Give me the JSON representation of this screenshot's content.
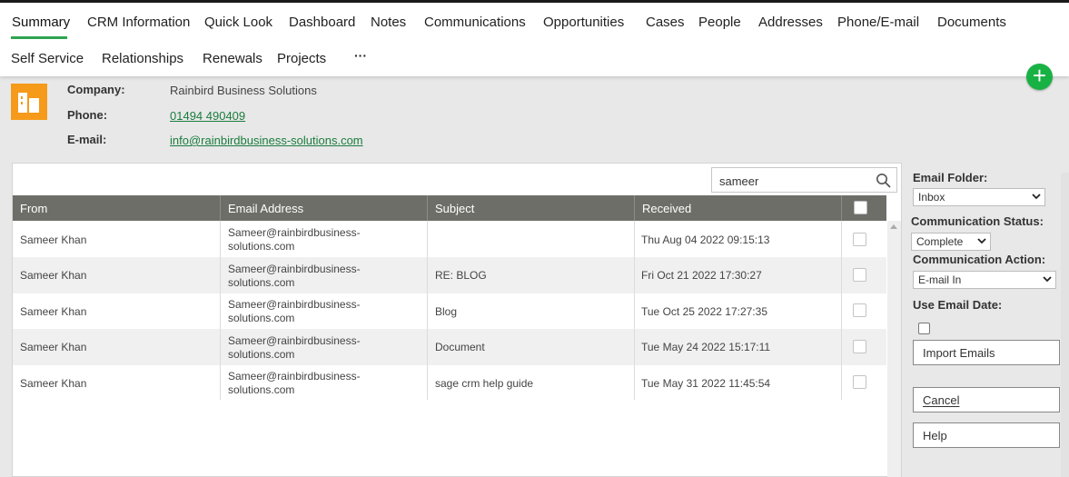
{
  "tabs": {
    "row1": [
      "Summary",
      "CRM Information",
      "Quick Look",
      "Dashboard",
      "Notes",
      "Communications",
      "Opportunities",
      "Cases",
      "People",
      "Addresses",
      "Phone/E-mail",
      "Documents"
    ],
    "row2": [
      "Self Service",
      "Relationships",
      "Renewals",
      "Projects"
    ],
    "more": "···"
  },
  "add_button": "+",
  "company": {
    "company_label": "Company:",
    "company_value": "Rainbird Business Solutions",
    "phone_label": "Phone:",
    "phone_value": "01494 490409",
    "email_label": "E-mail:",
    "email_value": "info@rainbirdbusiness-solutions.com"
  },
  "search": {
    "value": "sameer"
  },
  "table": {
    "columns": [
      "From",
      "Email Address",
      "Subject",
      "Received"
    ],
    "rows": [
      {
        "from": "Sameer Khan",
        "email_1": "Sameer@rainbirdbusiness-",
        "email_2": "solutions.com",
        "subject": "",
        "received": "Thu Aug 04 2022 09:15:13"
      },
      {
        "from": "Sameer Khan",
        "email_1": "Sameer@rainbirdbusiness-",
        "email_2": "solutions.com",
        "subject": "RE: BLOG",
        "received": "Fri Oct 21 2022 17:30:27"
      },
      {
        "from": "Sameer Khan",
        "email_1": "Sameer@rainbirdbusiness-",
        "email_2": "solutions.com",
        "subject": "Blog",
        "received": "Tue Oct 25 2022 17:27:35"
      },
      {
        "from": "Sameer Khan",
        "email_1": "Sameer@rainbirdbusiness-",
        "email_2": "solutions.com",
        "subject": "Document",
        "received": "Tue May 24 2022 15:17:11"
      },
      {
        "from": "Sameer Khan",
        "email_1": "Sameer@rainbirdbusiness-",
        "email_2": "solutions.com",
        "subject": "sage crm help guide",
        "received": "Tue May 31 2022 11:45:54"
      }
    ]
  },
  "sidebar": {
    "email_folder_label": "Email Folder:",
    "email_folder_value": "Inbox",
    "comm_status_label": "Communication Status:",
    "comm_status_value": "Complete",
    "comm_action_label": "Communication Action:",
    "comm_action_value": "E-mail In",
    "use_email_date_label": "Use Email Date:",
    "import_button": "Import Emails",
    "cancel_button": "Cancel",
    "help_button": "Help"
  },
  "colors": {
    "accent_green": "#2ea44f",
    "add_green": "#18b244",
    "company_orange": "#f59a1a",
    "header_gray": "#6e6e69"
  }
}
